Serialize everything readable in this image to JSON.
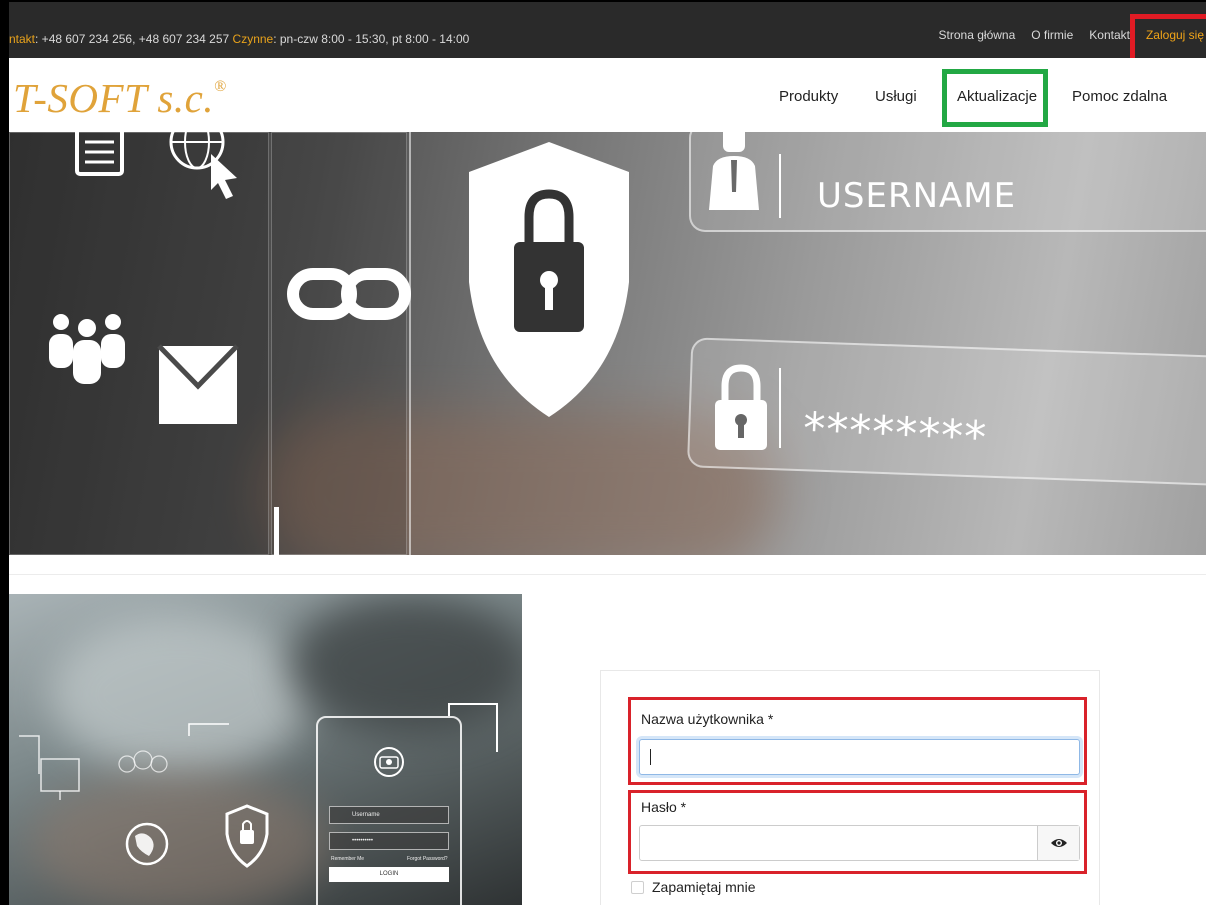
{
  "topbar": {
    "contact_label": "ntakt",
    "contact_phones": ": +48 607 234 256, +48 607 234 257 ",
    "hours_label": "Czynne",
    "hours_value": ": pn-czw 8:00 - 15:30, pt 8:00 - 14:00",
    "links": [
      "Strona główna",
      "O firmie",
      "Kontakt"
    ],
    "login": "Zaloguj się"
  },
  "header": {
    "logo": "T-SOFT s.c.",
    "logo_mark": "®",
    "nav": [
      "Produkty",
      "Usługi",
      "Aktualizacje",
      "Pomoc zdalna"
    ]
  },
  "hero": {
    "username_text": "USERNAME",
    "password_text": "********"
  },
  "illustration": {
    "username_text": "Username",
    "password_text": "••••••••••",
    "remember_text": "Remember Me",
    "forgot_text": "Forgot Password?",
    "login_text": "LOGIN"
  },
  "form": {
    "username_label": "Nazwa użytkownika *",
    "username_value": "",
    "password_label": "Hasło *",
    "password_value": "",
    "remember_label": "Zapamiętaj mnie"
  },
  "colors": {
    "accent_orange": "#e8a21b",
    "highlight_red": "#e01b24",
    "highlight_green": "#22a844"
  }
}
